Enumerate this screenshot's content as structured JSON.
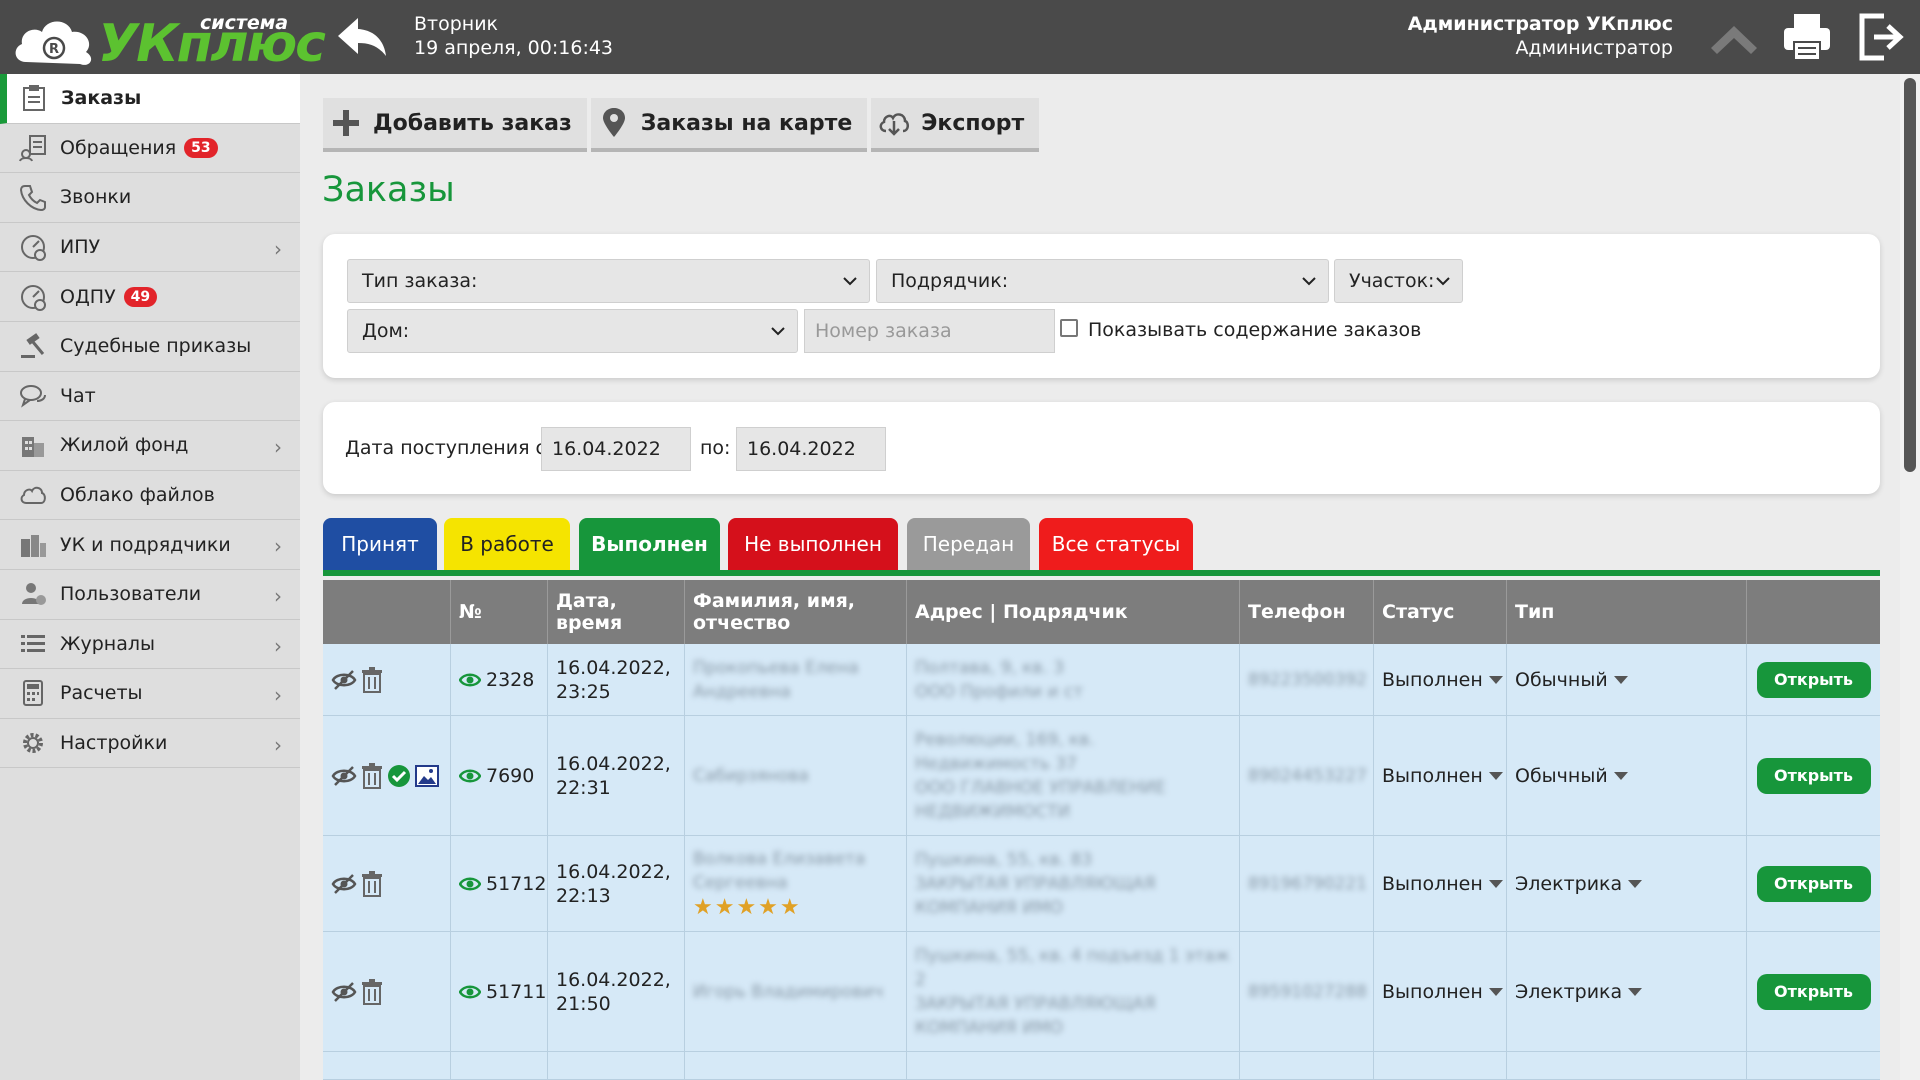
{
  "header": {
    "logo_small": "система",
    "logo_main": "УКплюс",
    "day": "Вторник",
    "date_time": "19 апреля, 00:16:43",
    "user_name": "Администратор УКплюс",
    "user_role": "Администратор"
  },
  "sidebar": {
    "items": [
      {
        "label": "Заказы",
        "icon": "clipboard-icon",
        "badge": "",
        "chevron": false
      },
      {
        "label": "Обращения",
        "icon": "request-icon",
        "badge": "53",
        "chevron": false
      },
      {
        "label": "Звонки",
        "icon": "phone-icon",
        "badge": "",
        "chevron": false
      },
      {
        "label": "ИПУ",
        "icon": "meter-icon",
        "badge": "",
        "chevron": true
      },
      {
        "label": "ОДПУ",
        "icon": "meter-icon",
        "badge": "49",
        "chevron": false
      },
      {
        "label": "Судебные приказы",
        "icon": "gavel-icon",
        "badge": "",
        "chevron": false
      },
      {
        "label": "Чат",
        "icon": "chat-icon",
        "badge": "",
        "chevron": false
      },
      {
        "label": "Жилой фонд",
        "icon": "building-icon",
        "badge": "",
        "chevron": true
      },
      {
        "label": "Облако файлов",
        "icon": "cloud-icon",
        "badge": "",
        "chevron": false
      },
      {
        "label": "УК и подрядчики",
        "icon": "company-icon",
        "badge": "",
        "chevron": true
      },
      {
        "label": "Пользователи",
        "icon": "users-icon",
        "badge": "",
        "chevron": true
      },
      {
        "label": "Журналы",
        "icon": "list-icon",
        "badge": "",
        "chevron": true
      },
      {
        "label": "Расчеты",
        "icon": "calculator-icon",
        "badge": "",
        "chevron": true
      },
      {
        "label": "Настройки",
        "icon": "gear-icon",
        "badge": "",
        "chevron": true
      }
    ]
  },
  "toolbar": {
    "add_label": "Добавить заказ",
    "map_label": "Заказы на карте",
    "export_label": "Экспорт"
  },
  "page_title": "Заказы",
  "filters": {
    "order_type": "Тип заказа:",
    "contractor": "Подрядчик:",
    "area": "Участок:",
    "house": "Дом:",
    "order_number_placeholder": "Номер заказа",
    "show_content_label": "Показывать содержание заказов"
  },
  "date_filter": {
    "label_from": "Дата поступления с:",
    "from_value": "16.04.2022",
    "label_to": "по:",
    "to_value": "16.04.2022"
  },
  "status_tabs": [
    {
      "label": "Принят",
      "bg": "#1f4ea3",
      "fg": "#ffffff"
    },
    {
      "label": "В работе",
      "bg": "#f5e400",
      "fg": "#222222"
    },
    {
      "label": "Выполнен",
      "bg": "#17963b",
      "fg": "#ffffff"
    },
    {
      "label": "Не выполнен",
      "bg": "#d5101b",
      "fg": "#ffffff"
    },
    {
      "label": "Передан",
      "bg": "#9a9a9a",
      "fg": "#ffffff"
    },
    {
      "label": "Все статусы",
      "bg": "#ef1c1c",
      "fg": "#ffffff"
    }
  ],
  "table": {
    "columns": [
      "",
      "№",
      "Дата, время",
      "Фамилия, имя, отчество",
      "Адрес | Подрядчик",
      "Телефон",
      "Статус",
      "Тип",
      ""
    ],
    "rows": [
      {
        "number": "2328",
        "date": "16.04.2022,",
        "time": "23:25",
        "name": "Прокопьева Елена Андреевна",
        "address": "Полтава, 9, кв. 3",
        "contractor": "ООО Профили и ст",
        "phone": "89223500392",
        "status": "Выполнен",
        "type": "Обычный",
        "open": "Открыть",
        "rating": ""
      },
      {
        "number": "7690",
        "date": "16.04.2022,",
        "time": "22:31",
        "name": "Сабирзянова",
        "address": "Революции, 169, кв. Недвижимость 37",
        "contractor": "ООО ГЛАВНОЕ УПРАВЛЕНИЕ НЕДВИЖИМОСТИ",
        "phone": "89024453227",
        "status": "Выполнен",
        "type": "Обычный",
        "open": "Открыть",
        "rating": ""
      },
      {
        "number": "51712",
        "date": "16.04.2022,",
        "time": "22:13",
        "name": "Волкова Елизавета Сергеевна",
        "address": "Пушкина, 55, кв. 83",
        "contractor": "ЗАКРЫТАЯ УПРАВЛЯЮЩАЯ КОМПАНИЯ ИМО",
        "phone": "89196790221",
        "status": "Выполнен",
        "type": "Электрика",
        "open": "Открыть",
        "rating": "★★★★★"
      },
      {
        "number": "51711",
        "date": "16.04.2022,",
        "time": "21:50",
        "name": "Игорь Владимирович",
        "address": "Пушкина, 55, кв. 4 подъезд 1 этаж 2",
        "contractor": "ЗАКРЫТАЯ УПРАВЛЯЮЩАЯ КОМПАНИЯ ИМО",
        "phone": "89591027288",
        "status": "Выполнен",
        "type": "Электрика",
        "open": "Открыть",
        "rating": ""
      }
    ]
  },
  "colors": {
    "brand_green": "#17963b",
    "header_bg": "#4a4a4a",
    "row_bg": "#d6e9f7",
    "badge_red": "#e2242a"
  }
}
